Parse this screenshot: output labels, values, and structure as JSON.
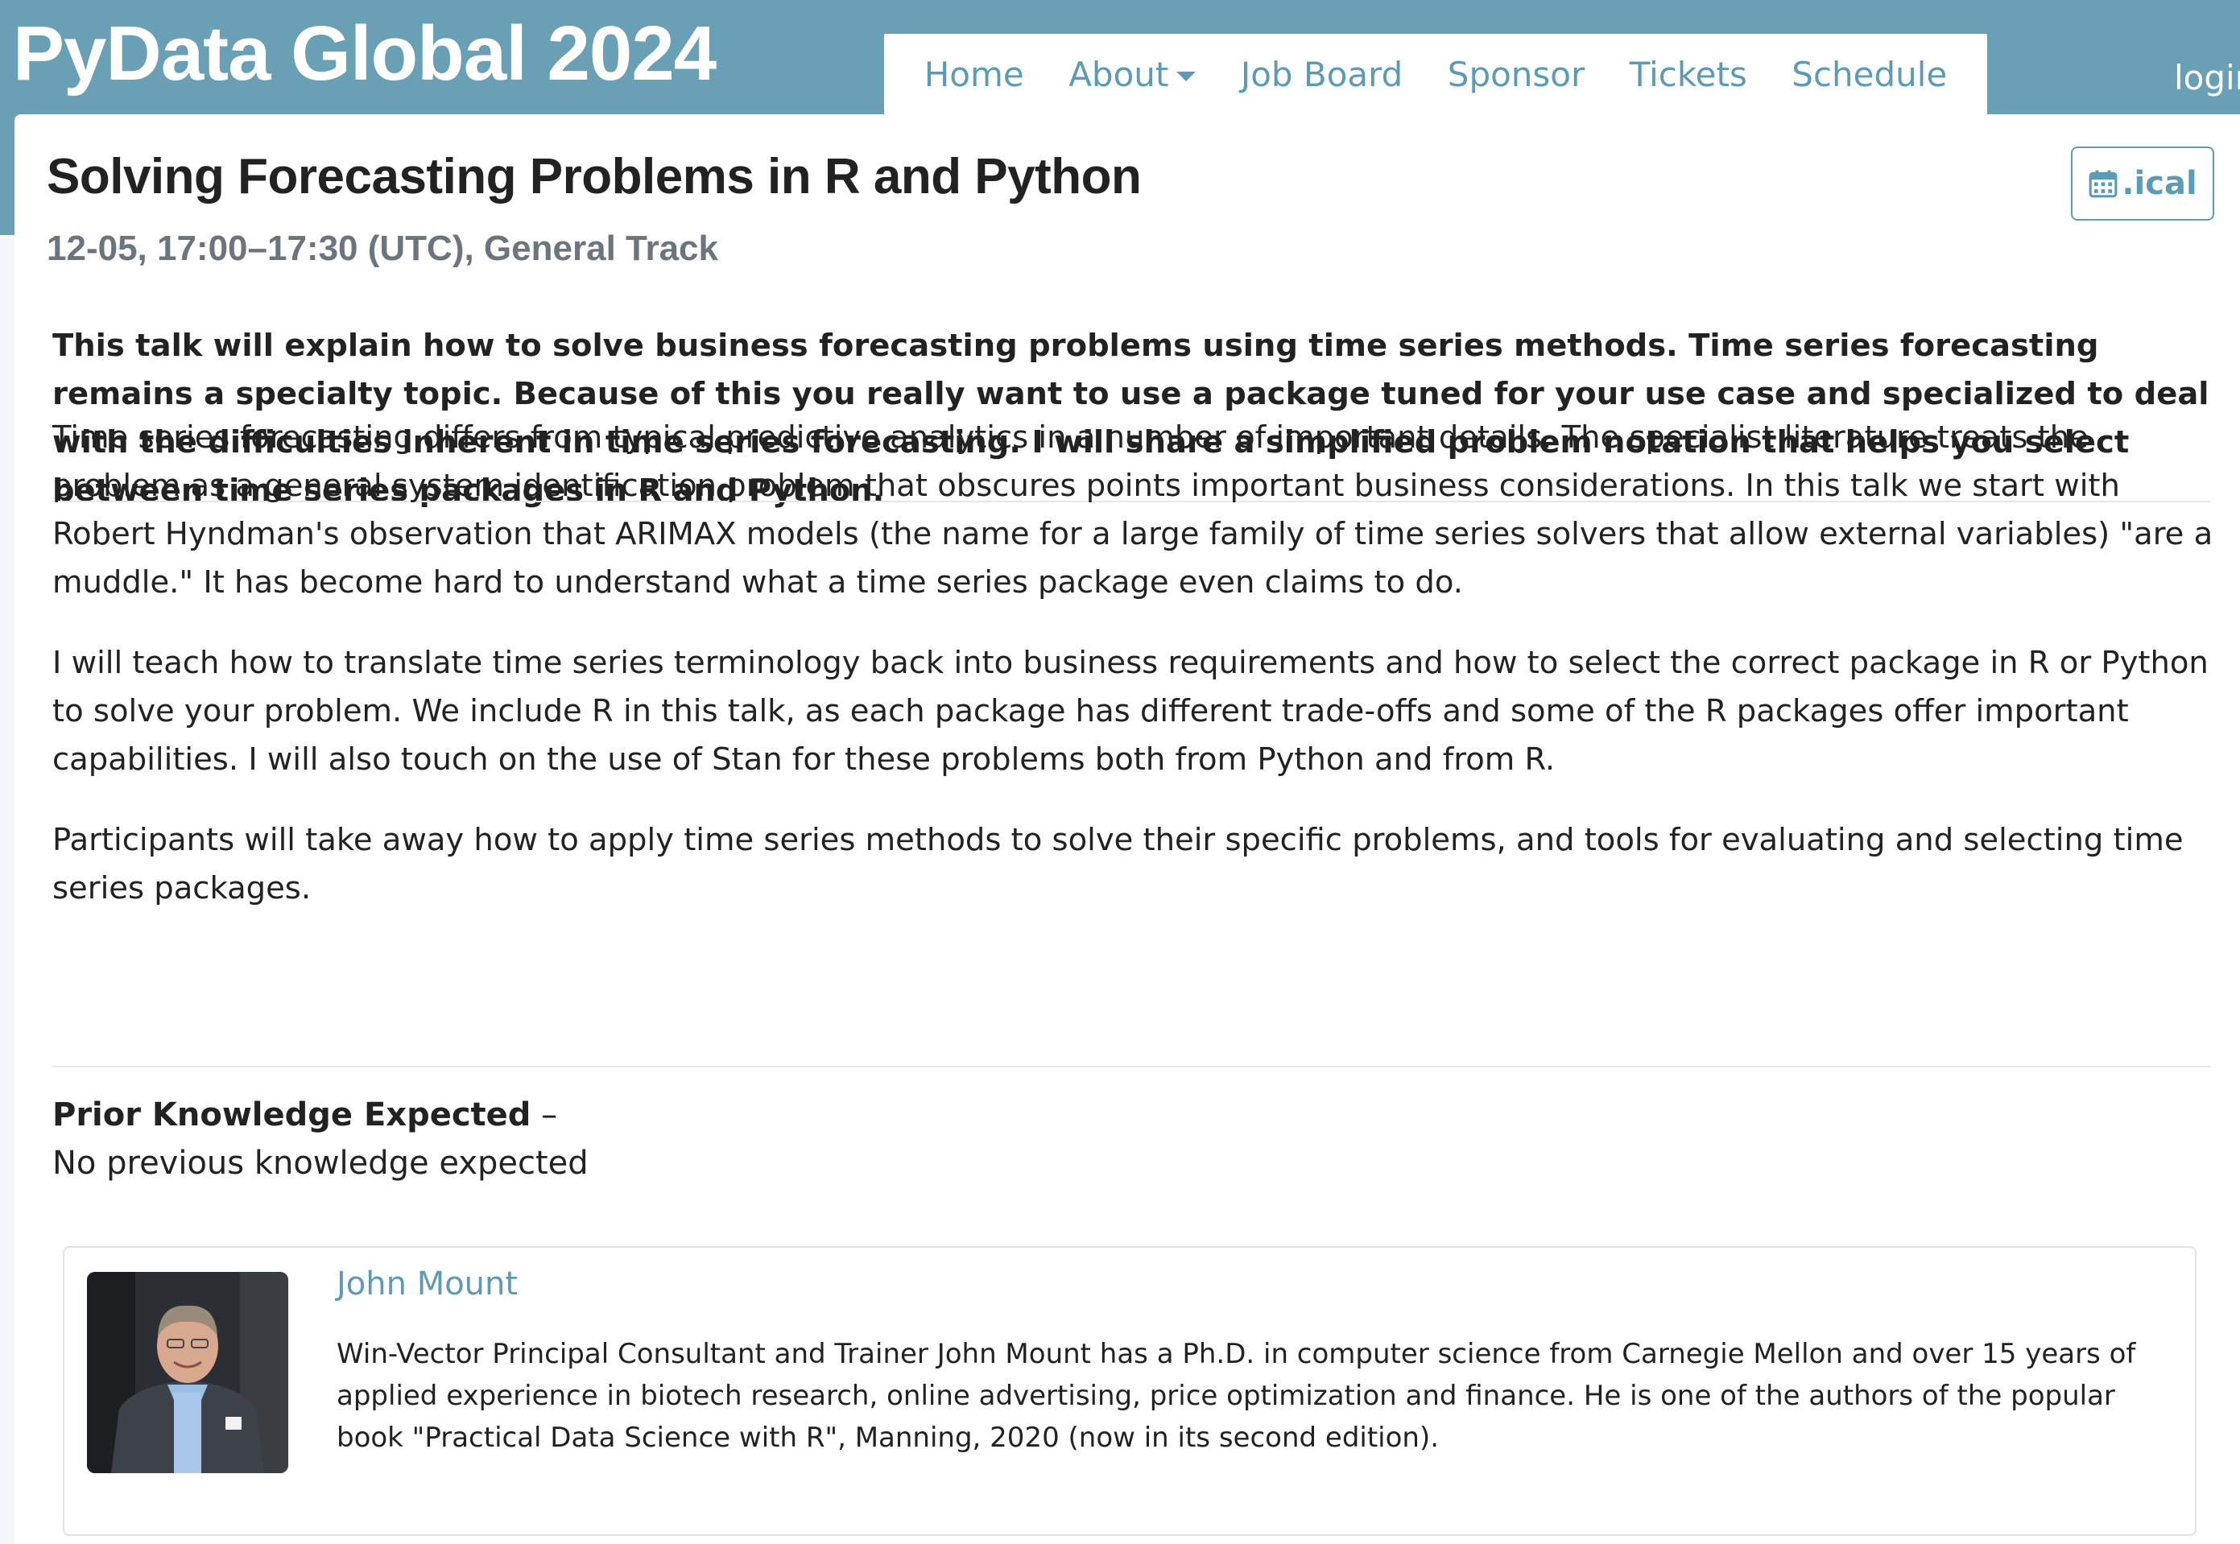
{
  "header": {
    "site_title": "PyData Global 2024",
    "login": "login",
    "brand_color": "#6aa0b6",
    "link_color": "#5d9ab4"
  },
  "nav": {
    "items": [
      {
        "label": "Home"
      },
      {
        "label": "About"
      },
      {
        "label": "Job Board"
      },
      {
        "label": "Sponsor"
      },
      {
        "label": "Tickets"
      },
      {
        "label": "Schedule"
      }
    ]
  },
  "talk": {
    "title": "Solving Forecasting Problems in R and Python",
    "meta": "12-05, 17:00–17:30 (UTC), General Track",
    "ical_label": ".ical",
    "abstract": "This talk will explain how to solve business forecasting problems using time series methods. Time series forecasting remains a specialty topic. Because of this you really want to use a package tuned for your use case and specialized to deal with the difficulties inherent in time series forecasting. I will share a simplified problem notation that helps you select between time series packages in R and Python.",
    "description": [
      "Time series forecasting differs from typical predictive analytics in a number of important details. The specialist literature treats the problem as a general system identification problem that obscures points important business considerations. In this talk we start with Robert Hyndman's observation that ARIMAX models (the name for a large family of time series solvers that allow external variables) \"are a muddle.\" It has become hard to understand what a time series package even claims to do.",
      "I will teach how to translate time series terminology back into business requirements and how to select the correct package in R or Python to solve your problem. We include R in this talk, as each package has different trade-offs and some of the R packages offer important capabilities. I will also touch on the use of Stan for these problems both from Python and from R.",
      "Participants will take away how to apply time series methods to solve their specific problems, and tools for evaluating and selecting time series packages."
    ],
    "prior_knowledge_label": "Prior Knowledge Expected",
    "prior_knowledge_dash": " –",
    "prior_knowledge_value": "No previous knowledge expected"
  },
  "speaker": {
    "name": "John Mount",
    "bio": "Win-Vector Principal Consultant and Trainer John Mount has a Ph.D. in computer science from Carnegie Mellon and over 15 years of applied experience in biotech research, online advertising, price optimization and finance. He is one of the authors of the popular book \"Practical Data Science with R\", Manning, 2020 (now in its second edition)."
  },
  "icons": {
    "dropdown": "caret-down-icon",
    "calendar": "calendar-icon",
    "avatar": "speaker-photo"
  }
}
